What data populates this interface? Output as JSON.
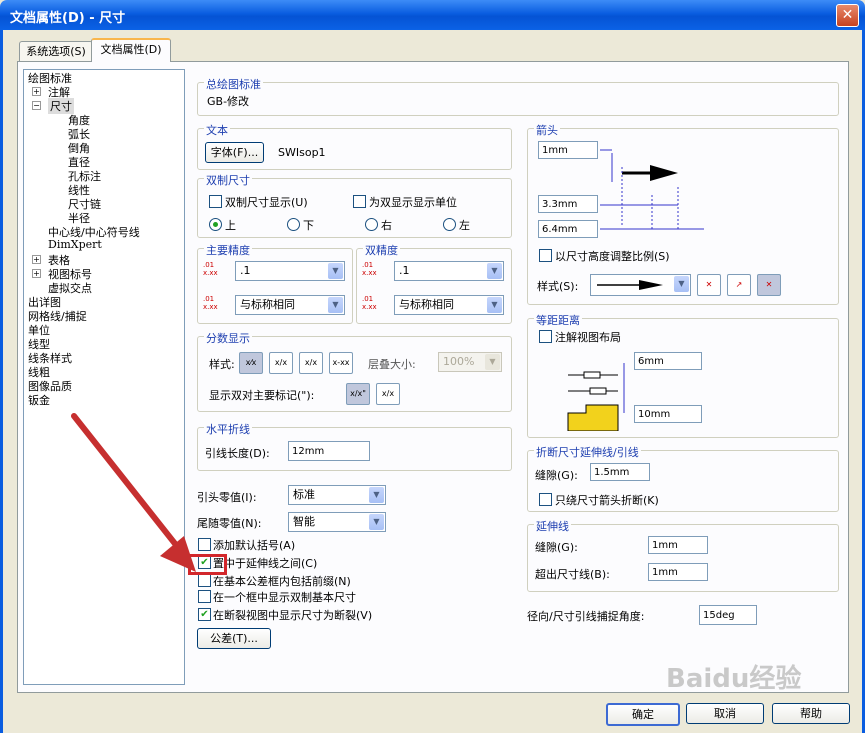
{
  "window": {
    "title": "文档属性(D) - 尺寸",
    "close_label": "✕"
  },
  "tabs": [
    "系统选项(S)",
    "文档属性(D)"
  ],
  "tree": [
    {
      "label": "绘图标准",
      "level": 0
    },
    {
      "label": "注解",
      "level": 1,
      "expander": "+"
    },
    {
      "label": "尺寸",
      "level": 1,
      "expander": "−",
      "selected": true
    },
    {
      "label": "角度",
      "level": 2
    },
    {
      "label": "弧长",
      "level": 2
    },
    {
      "label": "倒角",
      "level": 2
    },
    {
      "label": "直径",
      "level": 2
    },
    {
      "label": "孔标注",
      "level": 2
    },
    {
      "label": "线性",
      "level": 2
    },
    {
      "label": "尺寸链",
      "level": 2
    },
    {
      "label": "半径",
      "level": 2
    },
    {
      "label": "中心线/中心符号线",
      "level": 1
    },
    {
      "label": "DimXpert",
      "level": 1
    },
    {
      "label": "表格",
      "level": 1,
      "expander": "+"
    },
    {
      "label": "视图标号",
      "level": 1,
      "expander": "+"
    },
    {
      "label": "虚拟交点",
      "level": 1
    },
    {
      "label": "出详图",
      "level": 0
    },
    {
      "label": "网格线/捕捉",
      "level": 0
    },
    {
      "label": "单位",
      "level": 0
    },
    {
      "label": "线型",
      "level": 0
    },
    {
      "label": "线条样式",
      "level": 0
    },
    {
      "label": "线粗",
      "level": 0
    },
    {
      "label": "图像品质",
      "level": 0
    },
    {
      "label": "钣金",
      "level": 0
    }
  ],
  "standard": {
    "title": "总绘图标准",
    "value": "GB-修改"
  },
  "text": {
    "title": "文本",
    "font_button": "字体(F)...",
    "font_name": "SWIsop1"
  },
  "dual": {
    "title": "双制尺寸",
    "show_dual": "双制尺寸显示(U)",
    "show_units": "为双显示显示单位",
    "pos_top": "上",
    "pos_bottom": "下",
    "pos_right": "右",
    "pos_left": "左"
  },
  "primary_precision": {
    "title": "主要精度",
    "value1": ".1",
    "value2": "与标称相同"
  },
  "dual_precision": {
    "title": "双精度",
    "value1": ".1",
    "value2": "与标称相同"
  },
  "fraction": {
    "title": "分数显示",
    "style_label": "样式:",
    "stack_label": "层叠大小:",
    "stack_value": "100%",
    "dual_label": "显示双对主要标记(\"):",
    "icon1": "x⁄x",
    "icon2": "x/x",
    "icon3": "x/x",
    "icon4": "x-xx",
    "icon5": "x/x\"",
    "icon6": "x/x"
  },
  "break": {
    "title": "水平折线",
    "length_label": "引线长度(D):",
    "length_value": "12mm"
  },
  "zeros": {
    "leading_label": "引头零值(I):",
    "leading_value": "标准",
    "trailing_label": "尾随零值(N):",
    "trailing_value": "智能"
  },
  "options": [
    {
      "label": "添加默认括号(A)",
      "checked": false
    },
    {
      "label": "置中于延伸线之间(C)",
      "checked": true
    },
    {
      "label": "在基本公差框内包括前缀(N)",
      "checked": false
    },
    {
      "label": "在一个框中显示双制基本尺寸",
      "checked": false
    },
    {
      "label": "在断裂视图中显示尺寸为断裂(V)",
      "checked": true
    }
  ],
  "tolerance_button": "公差(T)...",
  "arrows": {
    "title": "箭头",
    "v1": "1mm",
    "v2": "3.3mm",
    "v3": "6.4mm",
    "scale_label": "以尺寸高度调整比例(S)",
    "style_label": "样式(S):"
  },
  "offset": {
    "title": "等距距离",
    "layout_label": "注解视图布局",
    "v1": "6mm",
    "v2": "10mm"
  },
  "break_ext": {
    "title": "折断尺寸延伸线/引线",
    "gap_label": "缝隙(G):",
    "gap_value": "1.5mm",
    "only_label": "只绕尺寸箭头折断(K)"
  },
  "extension": {
    "title": "延伸线",
    "gap_label": "缝隙(G):",
    "gap_value": "1mm",
    "beyond_label": "超出尺寸线(B):",
    "beyond_value": "1mm"
  },
  "radial": {
    "label": "径向/尺寸引线捕捉角度:",
    "value": "15deg"
  },
  "footer": {
    "ok": "确定",
    "cancel": "取消",
    "help": "帮助"
  },
  "watermark": "Baidu经验",
  "colors": {
    "titlebar": "#0a5de0",
    "group_title": "#1e3fb0",
    "highlight": "#d2262b",
    "arrow": "#c62f2f",
    "check": "#21a121"
  }
}
